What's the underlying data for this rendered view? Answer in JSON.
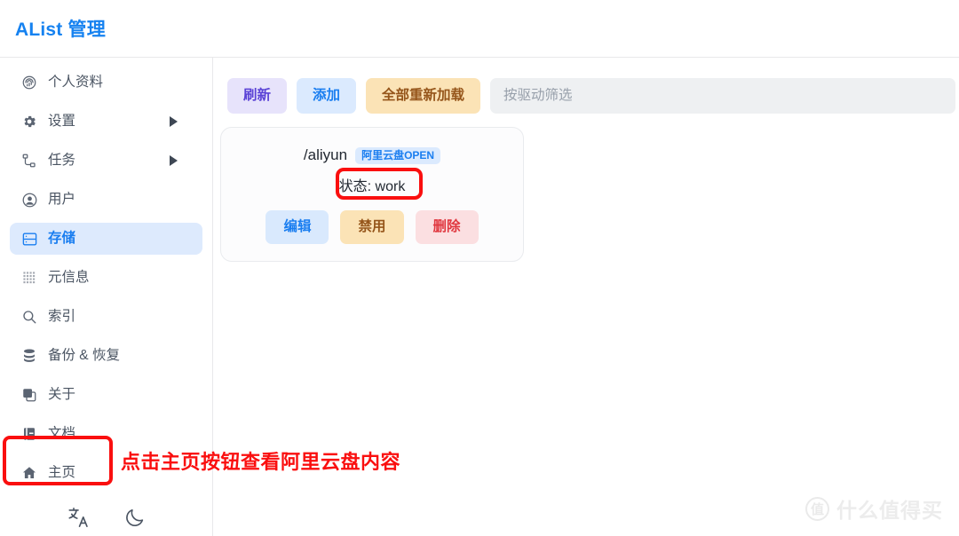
{
  "header": {
    "title": "AList 管理",
    "title_color": "#1682f0"
  },
  "sidebar": {
    "items": [
      {
        "label": "个人资料",
        "icon": "fingerprint-icon",
        "active": false,
        "has_caret": false
      },
      {
        "label": "设置",
        "icon": "gear-icon",
        "active": false,
        "has_caret": true
      },
      {
        "label": "任务",
        "icon": "task-tree-icon",
        "active": false,
        "has_caret": true
      },
      {
        "label": "用户",
        "icon": "user-circle-icon",
        "active": false,
        "has_caret": false
      },
      {
        "label": "存储",
        "icon": "storage-icon",
        "active": true,
        "has_caret": false
      },
      {
        "label": "元信息",
        "icon": "meta-grid-icon",
        "active": false,
        "has_caret": false
      },
      {
        "label": "索引",
        "icon": "search-icon",
        "active": false,
        "has_caret": false
      },
      {
        "label": "备份 & 恢复",
        "icon": "database-icon",
        "active": false,
        "has_caret": false
      },
      {
        "label": "关于",
        "icon": "layers-icon",
        "active": false,
        "has_caret": false
      },
      {
        "label": "文档",
        "icon": "book-icon",
        "active": false,
        "has_caret": false
      },
      {
        "label": "主页",
        "icon": "home-icon",
        "active": false,
        "has_caret": false
      }
    ],
    "footer": {
      "language_label": "文A",
      "language_icon": "language-icon",
      "theme_icon": "moon-icon"
    },
    "active_bg": "#ddeafd",
    "active_color": "#1a7ef0"
  },
  "toolbar": {
    "refresh_label": "刷新",
    "add_label": "添加",
    "reload_all_label": "全部重新加载",
    "filter_placeholder": "按驱动筛选",
    "filter_value": ""
  },
  "storage_card": {
    "path": "/aliyun",
    "badge": "阿里云盘OPEN",
    "status": "状态: work",
    "edit_label": "编辑",
    "disable_label": "禁用",
    "delete_label": "删除"
  },
  "annotations": {
    "color": "#fa0f0f",
    "callout_text": "点击主页按钮查看阿里云盘内容",
    "boxed_elements": [
      "状态: work",
      "主页"
    ]
  },
  "watermark": {
    "mark": "值",
    "text": "什么值得买"
  }
}
